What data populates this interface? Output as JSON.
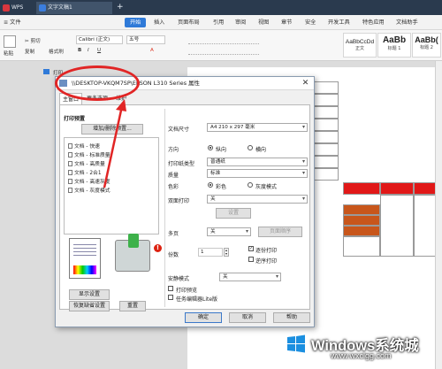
{
  "titlebar": {
    "tabs": [
      "WPS",
      "文字文稿1"
    ]
  },
  "menu": {
    "file": "≡ 文件",
    "items": [
      "开始",
      "插入",
      "页面布局",
      "引用",
      "审阅",
      "视图",
      "章节",
      "安全",
      "开发工具",
      "特色应用",
      "文档助手"
    ]
  },
  "toolbar": {
    "paste": "粘贴",
    "cut": "✂ 剪切",
    "copy": "复制",
    "format_painter": "格式刷",
    "font_name": "Calibri (正文)",
    "font_size": "五号",
    "bold": "B",
    "italic": "I",
    "underline": "U",
    "font_color": "A",
    "styles": [
      {
        "sample": "AaBbCcDd",
        "name": "正文"
      },
      {
        "sample": "AaBb",
        "name": "标题 1"
      },
      {
        "sample": "AaBb(",
        "name": "标题 2"
      }
    ]
  },
  "print_outer": {
    "title": "打印"
  },
  "dialog": {
    "title": "\\\\DESKTOP-VKQM7SP\\EPSON L310 Series 属性",
    "close": "✕",
    "tabs": [
      "主窗口",
      "更多选项",
      "维护"
    ],
    "presets": {
      "heading": "打印预置",
      "add_button": "增加/删除预置...",
      "items": [
        "文档 - 快速",
        "文档 - 标准质量",
        "文档 - 高质量",
        "文档 - 2合1",
        "文档 - 高速灰度",
        "文档 - 灰度模式"
      ]
    },
    "preview_button": "显示设置",
    "reset_button": "恢复缺省设置",
    "redo_button": "重置",
    "fields": {
      "size_label": "文档尺寸",
      "size_value": "A4 210 x 297 毫米",
      "orientation_label": "方向",
      "portrait": "纵向",
      "landscape": "横向",
      "paper_type_label": "打印纸类型",
      "paper_type_value": "普通纸",
      "quality_label": "质量",
      "quality_value": "标准",
      "color_label": "色彩",
      "color_option": "彩色",
      "gray_option": "灰度模式",
      "duplex_label": "双面打印",
      "duplex_value": "关",
      "settings_button": "设置",
      "multi_page_label": "多页",
      "multi_page_value": "关",
      "page_order_button": "页面顺序",
      "copies_label": "份数",
      "copies_value": "1",
      "collate": "逐份打印",
      "reverse": "逆序打印",
      "quiet_label": "安静模式",
      "quiet_value": "关",
      "print_preview": "打印预览",
      "job_arranger": "任务编辑器Lite版"
    },
    "footer": {
      "ok": "确定",
      "cancel": "取消",
      "help": "帮助"
    }
  },
  "watermark": {
    "main": "Windows系统城",
    "url": "www.wxclgg.com"
  },
  "colors": {
    "titlebar": "#2a3a4e",
    "accent_blue": "#2f7ad8",
    "annotation_red": "#e12525",
    "table_red": "#e11818",
    "table_brown": "#c8561b"
  }
}
